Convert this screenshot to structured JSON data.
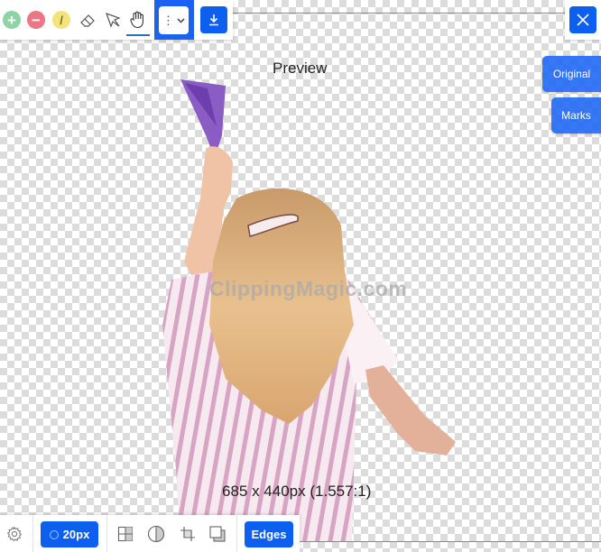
{
  "toolbar_top": {
    "tools": [
      {
        "name": "keep-brush",
        "icon": "plus-circle-icon",
        "glyph": "+"
      },
      {
        "name": "remove-brush",
        "icon": "minus-circle-icon",
        "glyph": "−"
      },
      {
        "name": "hair-brush",
        "icon": "slash-circle-icon",
        "glyph": "/"
      },
      {
        "name": "eraser",
        "icon": "eraser-icon"
      },
      {
        "name": "scalpel",
        "icon": "scalpel-icon"
      },
      {
        "name": "pan",
        "icon": "hand-icon",
        "active": true
      }
    ],
    "more_label": "⋮",
    "more_chevron": "⌄",
    "download_icon": "download-icon"
  },
  "close_icon": "close-icon",
  "side_buttons": {
    "original": "Original",
    "marks": "Marks"
  },
  "canvas": {
    "preview_label": "Preview",
    "watermark": "ClippingMagic.com",
    "dimensions": "685 x 440px (1.557:1)"
  },
  "toolbar_bottom": {
    "settings_icon": "gear-icon",
    "brush_size_label": "20px",
    "view_icons": [
      "grid-icon",
      "contrast-icon",
      "crop-icon",
      "shadow-icon"
    ],
    "edges_label": "Edges"
  },
  "colors": {
    "accent": "#0d5ff0",
    "keep": "#8dd3a3",
    "remove": "#ec7685",
    "hair": "#f4e37a"
  }
}
